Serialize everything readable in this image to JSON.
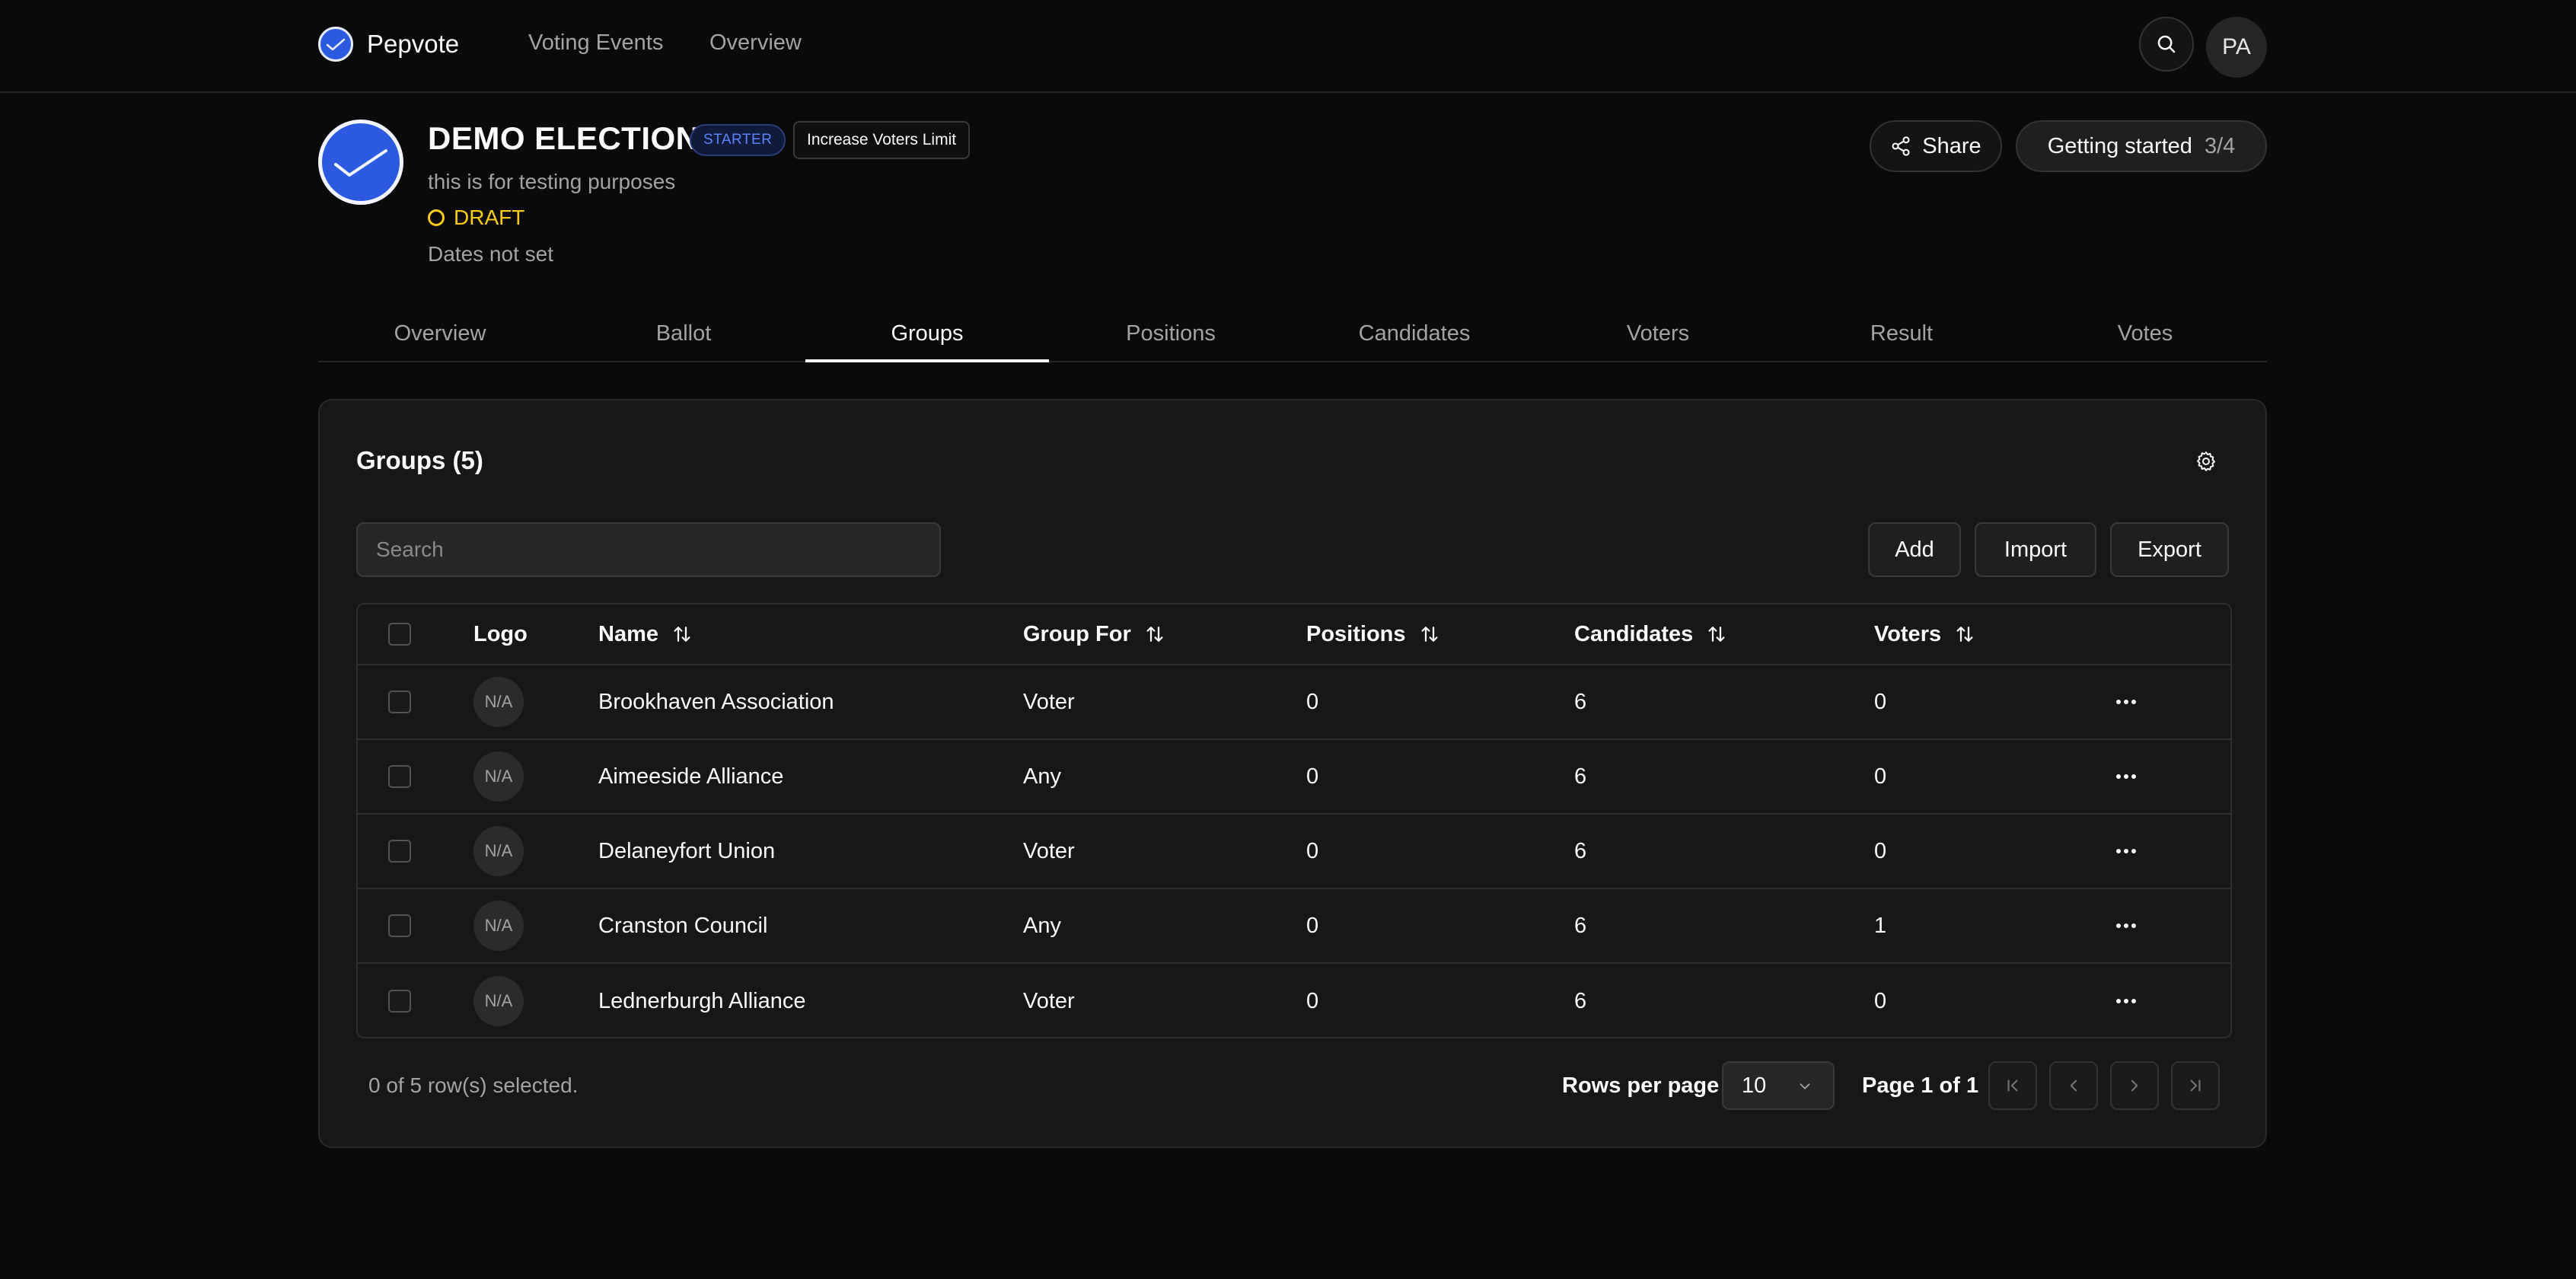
{
  "app": {
    "name": "Pepvote",
    "nav": [
      "Voting Events",
      "Overview"
    ],
    "avatar_initials": "PA",
    "accent_color": "#2b59e0"
  },
  "election": {
    "title": "DEMO ELECTION",
    "plan_badge": "STARTER",
    "increase_label": "Increase Voters Limit",
    "description": "this is for testing purposes",
    "status": "DRAFT",
    "status_color": "#facc15",
    "dates": "Dates not set",
    "share_label": "Share",
    "getting_started_label": "Getting started",
    "getting_started_progress": "3/4"
  },
  "tabs": [
    "Overview",
    "Ballot",
    "Groups",
    "Positions",
    "Candidates",
    "Voters",
    "Result",
    "Votes"
  ],
  "active_tab": "Groups",
  "groups": {
    "title": "Groups (5)",
    "search_placeholder": "Search",
    "actions": {
      "add": "Add",
      "import": "Import",
      "export": "Export"
    },
    "columns": [
      "Logo",
      "Name",
      "Group For",
      "Positions",
      "Candidates",
      "Voters"
    ],
    "rows": [
      {
        "logo": "N/A",
        "name": "Brookhaven Association",
        "group_for": "Voter",
        "positions": "0",
        "candidates": "6",
        "voters": "0"
      },
      {
        "logo": "N/A",
        "name": "Aimeeside Alliance",
        "group_for": "Any",
        "positions": "0",
        "candidates": "6",
        "voters": "0"
      },
      {
        "logo": "N/A",
        "name": "Delaneyfort Union",
        "group_for": "Voter",
        "positions": "0",
        "candidates": "6",
        "voters": "0"
      },
      {
        "logo": "N/A",
        "name": "Cranston Council",
        "group_for": "Any",
        "positions": "0",
        "candidates": "6",
        "voters": "1"
      },
      {
        "logo": "N/A",
        "name": "Lednerburgh Alliance",
        "group_for": "Voter",
        "positions": "0",
        "candidates": "6",
        "voters": "0"
      }
    ],
    "selection_text": "0 of 5 row(s) selected.",
    "rows_per_page_label": "Rows per page",
    "rows_per_page_value": "10",
    "page_text": "Page 1 of 1"
  }
}
